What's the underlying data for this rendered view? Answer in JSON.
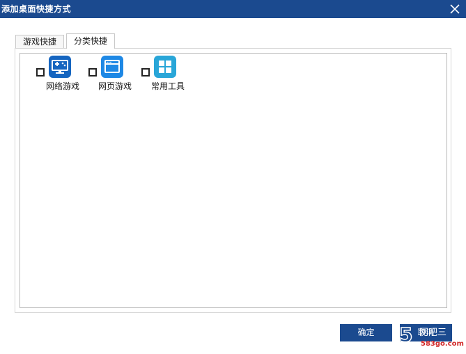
{
  "window": {
    "title": "添加桌面快捷方式"
  },
  "tabs": [
    {
      "label": "游戏快捷",
      "active": false
    },
    {
      "label": "分类快捷",
      "active": true
    }
  ],
  "shortcuts": [
    {
      "label": "网络游戏",
      "icon": "gamepad-monitor-icon",
      "color": "#1565c0",
      "checked": false
    },
    {
      "label": "网页游戏",
      "icon": "browser-window-icon",
      "color": "#1e88e5",
      "checked": false
    },
    {
      "label": "常用工具",
      "icon": "tools-grid-icon",
      "color": "#29a6d8",
      "checked": false
    }
  ],
  "buttons": {
    "ok": "确定",
    "cancel": "取消"
  },
  "watermark": {
    "text": "583go.com",
    "logo": "网吧三"
  },
  "colors": {
    "titlebar": "#1b4a8f",
    "button": "#1b4a8f"
  }
}
